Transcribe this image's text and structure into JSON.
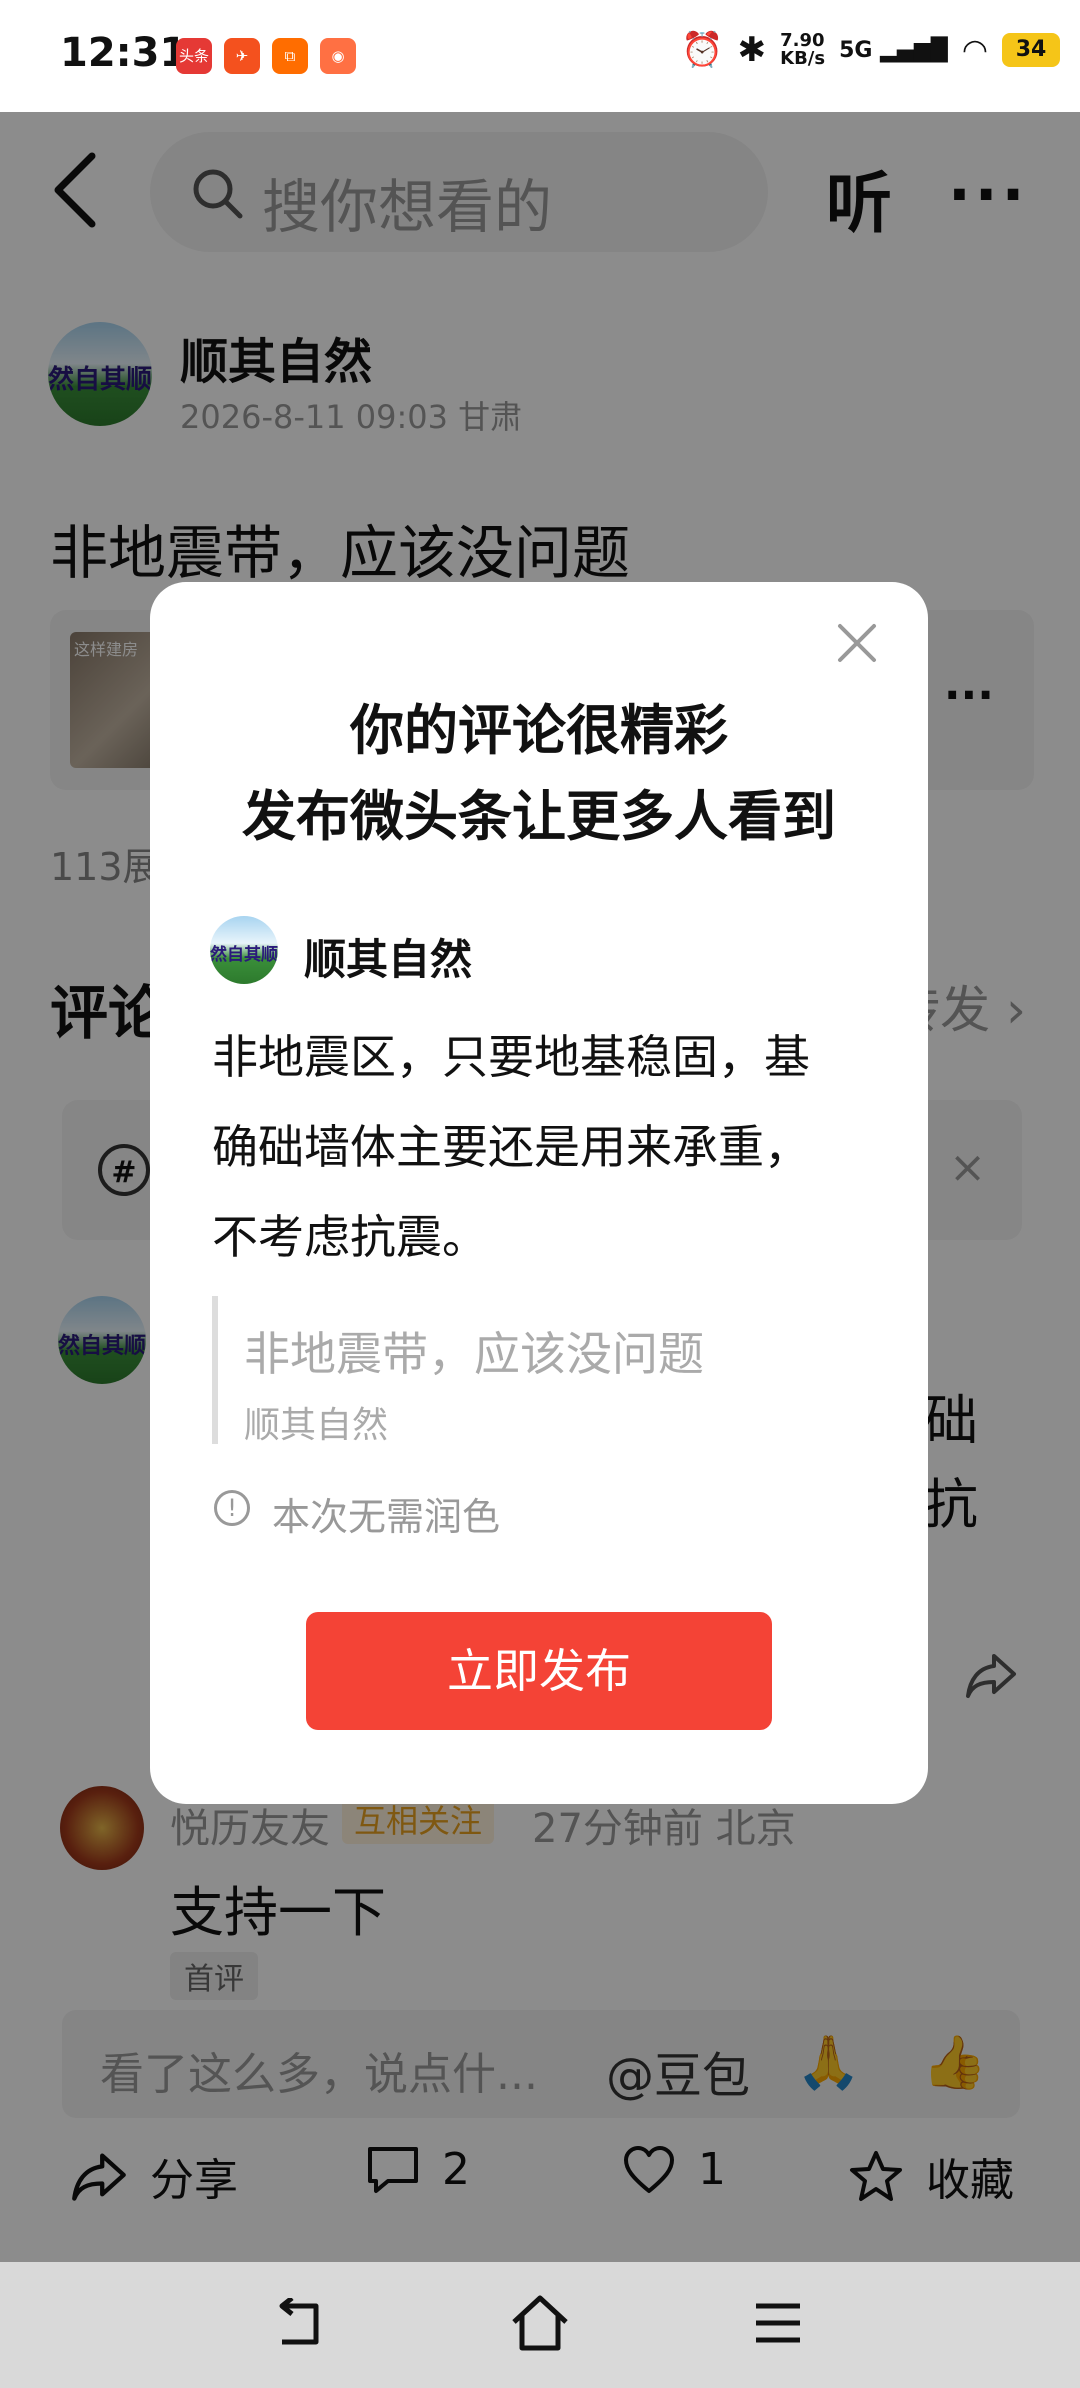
{
  "status": {
    "time": "12:31",
    "app_icons": [
      "头条",
      "✈",
      "⧉",
      "◉"
    ],
    "net_speed": "7.90\nKB/s",
    "network": "5G",
    "battery": "34"
  },
  "header": {
    "search_placeholder": "搜你想看的",
    "listen_label": "听",
    "more_label": "···"
  },
  "post": {
    "author": "顺其自然",
    "avatar_text": "然自其顺",
    "meta": "2026-8-11 09:03 甘肃",
    "text": "非地震带，应该没问题",
    "card_thumb_caption": "这样建房",
    "card_more": "···",
    "views": "113展"
  },
  "comments": {
    "title": "评论",
    "repost_label": "转发 ›",
    "topic_icon": "#",
    "topic_close": "×",
    "partial_right_1": "础",
    "partial_right_2": "抗",
    "second": {
      "name": "悦历友友",
      "tag": "互相关注",
      "time": "27分钟前 北京",
      "text": "支持一下",
      "badge": "首评"
    }
  },
  "input": {
    "placeholder": "看了这么多，说点什...",
    "doubao": "@豆包",
    "emoji1": "🙏",
    "emoji2": "👍"
  },
  "actions": {
    "share": "分享",
    "comments_count": "2",
    "likes_count": "1",
    "favorite": "收藏"
  },
  "nav": {
    "back": "⮌",
    "home": "⌂",
    "menu": "☰"
  },
  "modal": {
    "title_line1": "你的评论很精彩",
    "title_line2": "发布微头条让更多人看到",
    "author": "顺其自然",
    "body": "非地震区，只要地基稳固，基确础墙体主要还是用来承重，不考虑抗震。",
    "quote_text": "非地震带，应该没问题",
    "quote_author": "顺其自然",
    "info": "本次无需润色",
    "publish": "立即发布"
  },
  "colors": {
    "accent": "#f44336",
    "tag": "#e8a020"
  }
}
